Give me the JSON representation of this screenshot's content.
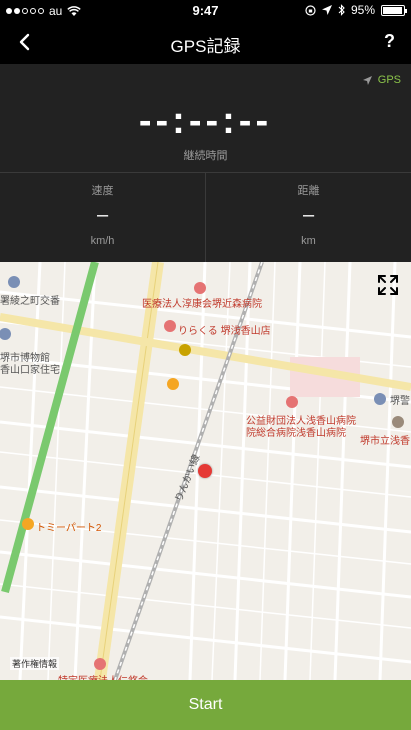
{
  "status_bar": {
    "carrier": "au",
    "time": "9:47",
    "battery": "95%",
    "battery_level": 0.95
  },
  "nav": {
    "title": "GPS記録",
    "help": "?"
  },
  "gps_indicator": "GPS",
  "duration": {
    "value": "--:--:--",
    "label": "継続時間"
  },
  "stats": {
    "speed": {
      "label": "速度",
      "value": "–",
      "unit": "km/h"
    },
    "distance": {
      "label": "距離",
      "value": "–",
      "unit": "km"
    }
  },
  "map": {
    "labels": [
      "医療法人淳康会堺近森病院",
      "りらくる 堺浅香山店",
      "公益財団法人浅香山病院",
      "院総合病院浅香山病院",
      "堺市立浅香山",
      "トミーパート2",
      "堺市博物館",
      "香山口家住宅",
      "署綾之町交番",
      "りんかい線",
      "特定医療法人仁悠会",
      "堺警"
    ],
    "copyright": "著作権情報"
  },
  "start_button": "Start",
  "colors": {
    "accent_green": "#76a93c",
    "gps_green": "#8bc34a",
    "pin_red": "#e53935"
  }
}
